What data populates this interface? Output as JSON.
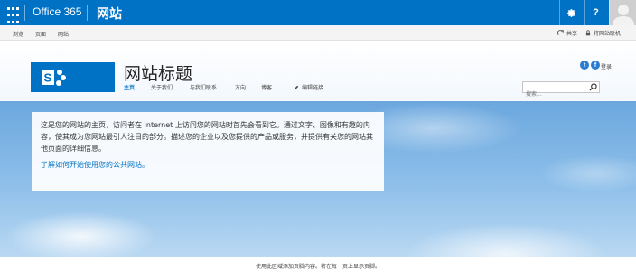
{
  "suite_bar": {
    "brand": "Office 365",
    "app_name": "网站",
    "buttons": [
      "gear-icon",
      "help-icon"
    ],
    "help_label": "?",
    "accent_color": "#0072c6"
  },
  "ribbon": {
    "tabs": [
      "浏览",
      "页面",
      "网站"
    ],
    "share_label": "共享",
    "offline_label": "将网站联机"
  },
  "header": {
    "site_title": "网站标题",
    "nav": [
      "主页",
      "关于我们",
      "与我们联系",
      "方向",
      "博客"
    ],
    "selected_nav": "主页",
    "edit_links_label": "编辑链接",
    "login_label": "登录",
    "social": [
      "twitter-icon",
      "facebook-icon"
    ],
    "social_glyphs": [
      "t",
      "f"
    ],
    "search_placeholder": "搜索..."
  },
  "welcome": {
    "body": "这是您的网站的主页，访问者在 Internet 上访问您的网站时首先会看到它。通过文字、图像和有趣的内容，使其成为您网站最引人注目的部分。描述您的企业以及您提供的产品或服务，并提供有关您的网站其他页面的详细信息。",
    "link": "了解如何开始使用您的公共网站。"
  },
  "footer": {
    "text": "使用此区域添加页脚内容。将在每一页上显示页脚。"
  }
}
